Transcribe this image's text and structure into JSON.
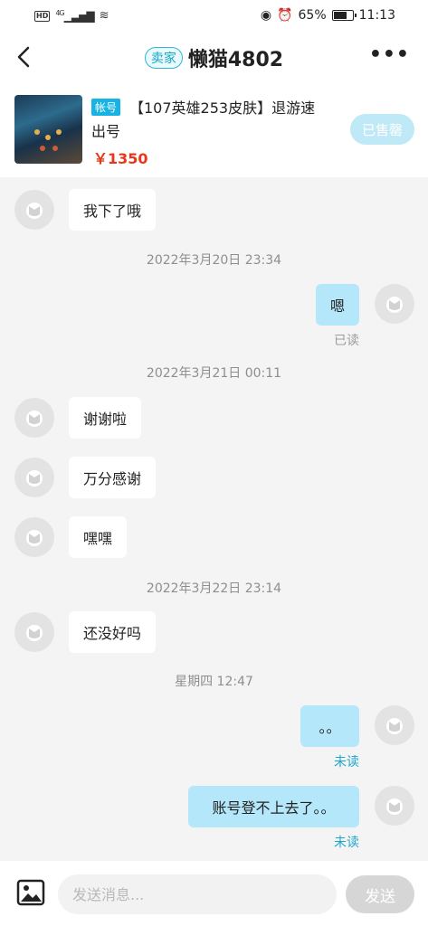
{
  "status_bar": {
    "hd": "HD",
    "network": "4G",
    "battery_percent": "65%",
    "battery_level": 0.65,
    "time": "11:13"
  },
  "header": {
    "seller_badge": "卖家",
    "title": "懒猫4802",
    "more_label": "•••"
  },
  "product": {
    "tag": "帐号",
    "title_line1": "【107英雄253皮肤】退游速",
    "title_line2": "出号",
    "price": "￥1350",
    "sold_label": "已售罄"
  },
  "messages": [
    {
      "text": "我下了哦"
    },
    {
      "time": "2022年3月20日 23:34"
    },
    {
      "text": "嗯",
      "status": "已读"
    },
    {
      "time": "2022年3月21日 00:11"
    },
    {
      "text": "谢谢啦"
    },
    {
      "text": "万分感谢"
    },
    {
      "text": "嘿嘿"
    },
    {
      "time": "2022年3月22日 23:14"
    },
    {
      "text": "还没好吗"
    },
    {
      "time": "星期四 12:47"
    },
    {
      "text": "。。",
      "status": "未读"
    },
    {
      "text": "账号登不上去了。。",
      "status": "未读"
    }
  ],
  "input_bar": {
    "placeholder": "发送消息...",
    "send_label": "发送"
  },
  "colors": {
    "accent": "#17b3e4",
    "outgoing_bubble": "#b4e7fa",
    "price": "#e8361b",
    "unread": "#1ba7cc"
  }
}
